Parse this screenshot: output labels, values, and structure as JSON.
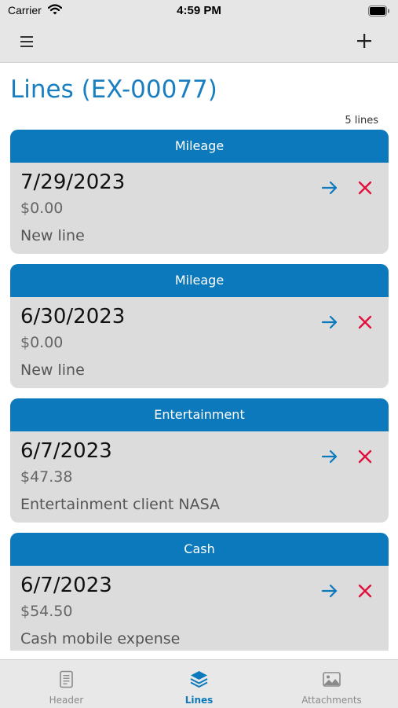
{
  "status": {
    "carrier": "Carrier",
    "time": "4:59 PM"
  },
  "page": {
    "title": "Lines (EX-00077)",
    "count_label": "5 lines"
  },
  "icons": {
    "menu": "hamburger-menu-icon",
    "add": "plus-icon",
    "open": "arrow-right-icon",
    "delete": "close-x-icon"
  },
  "colors": {
    "accent": "#0c79bc",
    "delete": "#e0103a",
    "card_bg": "#dcdcdc"
  },
  "lines": [
    {
      "category": "Mileage",
      "date": "7/29/2023",
      "amount": "$0.00",
      "description": "New line"
    },
    {
      "category": "Mileage",
      "date": "6/30/2023",
      "amount": "$0.00",
      "description": "New line"
    },
    {
      "category": "Entertainment",
      "date": "6/7/2023",
      "amount": "$47.38",
      "description": "Entertainment client NASA"
    },
    {
      "category": "Cash",
      "date": "6/7/2023",
      "amount": "$54.50",
      "description": "Cash mobile expense"
    }
  ],
  "tabs": [
    {
      "label": "Header",
      "icon": "document-icon",
      "active": false
    },
    {
      "label": "Lines",
      "icon": "layers-icon",
      "active": true
    },
    {
      "label": "Attachments",
      "icon": "image-icon",
      "active": false
    }
  ]
}
